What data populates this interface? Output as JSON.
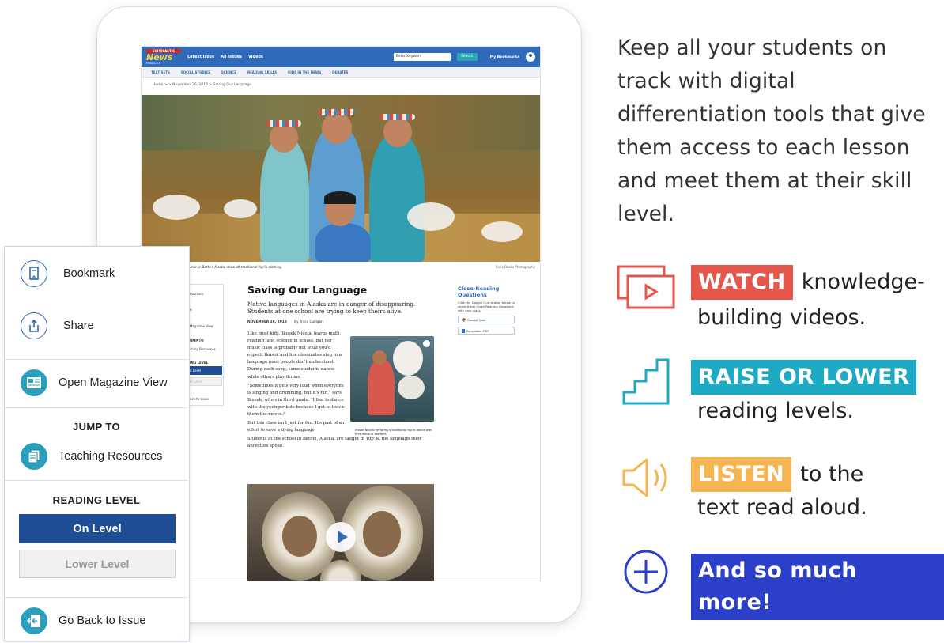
{
  "site": {
    "brand_top": "SCHOLASTIC",
    "brand_name": "News",
    "brand_edition": "Editions 5-6",
    "nav": [
      "Latest Issue",
      "All Issues",
      "Videos"
    ],
    "search_placeholder": "Enter Keyword",
    "search_button": "Search",
    "my_bookmarks": "My Bookmarks",
    "subnav": [
      "TEXT SETS",
      "SOCIAL STUDIES",
      "SCIENCE",
      "READING SKILLS",
      "KIDS IN THE NEWS",
      "DEBATES"
    ],
    "breadcrumb": "Home > > November 26, 2018 > Saving Our Language"
  },
  "hero": {
    "caption": "Kurvin in Bethel, Alaska, show off traditional Yup'ik clothing.",
    "credit": "Katie Basile Photography"
  },
  "article": {
    "title": "Saving Our Language",
    "deck": "Native languages in Alaska are in danger of disappearing. Students at one school are trying to keep theirs alive.",
    "date": "NOVEMBER 26, 2018",
    "author": "By Tricia Culligan",
    "para1": "Like most kids, Ikusek Nicolai learns math, reading, and science in school. But her music class is probably not what you'd expect. Ikusek and her classmates sing in a language most people don't understand. During each song, some students dance while others play drums.",
    "para2": "\"Sometimes it gets very loud when everyone is singing and drumming, but it's fun,\" says Ikusek, who's in third grade. \"I like to dance with the younger kids because I get to teach them the moves.\"",
    "para3": "But this class isn't just for fun. It's part of an effort to save a dying language.",
    "para4": "Students at the school in Bethel, Alaska, are taught in Yup'ik, the language their ancestors spoke.",
    "inline_caption": "Ikusek Nicolai performs a traditional Yup'ik dance with fans made of feathers.",
    "inline_credit": "Katie Basile Photography"
  },
  "close_reading": {
    "title": "Close-Reading Questions",
    "text": "Click the Google Quiz button below to share these Close-Reading Questions with your class.",
    "quiz_button": "Google Quiz",
    "pdf_button": "Download .PDF"
  },
  "mini_panel": {
    "items": [
      "ookmark",
      "e",
      "Magazine View",
      "UMP TO",
      "ching Resources",
      "ING LEVEL",
      "n Level",
      "er Level",
      "ack to Issue"
    ]
  },
  "panel": {
    "bookmark": "Bookmark",
    "share": "Share",
    "magazine_view": "Open Magazine View",
    "jump_to": "JUMP TO",
    "teaching_resources": "Teaching Resources",
    "reading_level": "READING LEVEL",
    "on_level": "On Level",
    "lower_level": "Lower Level",
    "go_back": "Go Back to Issue"
  },
  "marketing": {
    "headline": "Keep all your students on track with digital differentiation tools that give them access to each lesson and meet them at their skill level.",
    "features": [
      {
        "tag": "WATCH",
        "text1": "knowledge-",
        "text2": "building videos.",
        "color": "#e5574c"
      },
      {
        "tag": "RAISE OR LOWER",
        "text1": "",
        "text2": "reading levels.",
        "color": "#1ea9c4"
      },
      {
        "tag": "LISTEN",
        "text1": "to the",
        "text2": "text read aloud.",
        "color": "#f5b552"
      },
      {
        "tag": "And so much more!",
        "text1": "",
        "text2": "",
        "color": "#2b3fc8"
      }
    ]
  },
  "colors": {
    "brand_blue": "#2f69b8",
    "on_level": "#1f4d93",
    "teal": "#2a9fbe"
  }
}
